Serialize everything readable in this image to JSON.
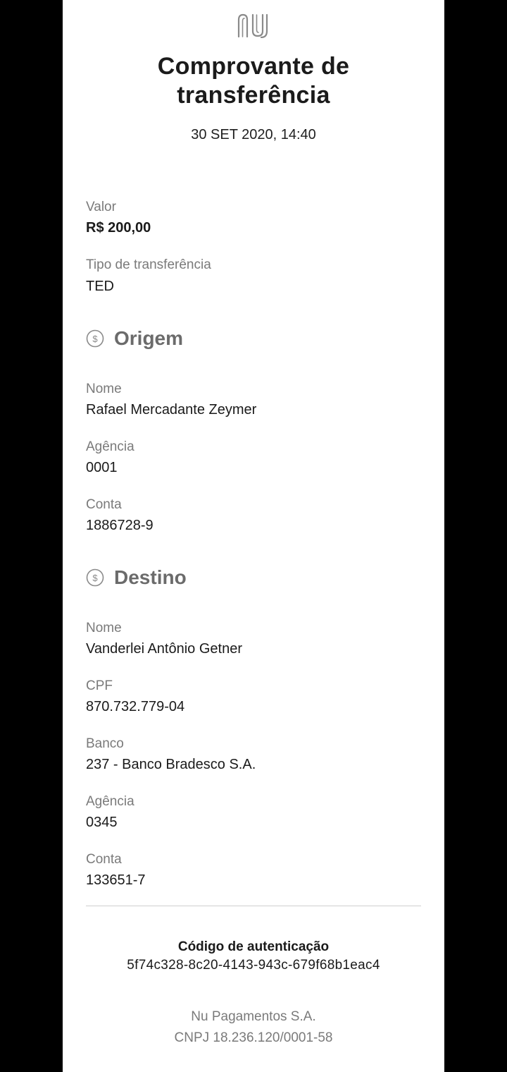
{
  "header": {
    "logo_icon": "nu-logo-icon",
    "title_line1": "Comprovante de",
    "title_line2": "transferência",
    "date": "30 SET 2020, 14:40"
  },
  "summary": {
    "valor_label": "Valor",
    "valor_value": "R$ 200,00",
    "tipo_label": "Tipo de transferência",
    "tipo_value": "TED"
  },
  "origem": {
    "icon": "money-circle-icon",
    "title": "Origem",
    "nome_label": "Nome",
    "nome_value": "Rafael Mercadante Zeymer",
    "agencia_label": "Agência",
    "agencia_value": "0001",
    "conta_label": "Conta",
    "conta_value": "1886728-9"
  },
  "destino": {
    "icon": "money-circle-icon",
    "title": "Destino",
    "nome_label": "Nome",
    "nome_value": "Vanderlei Antônio Getner",
    "cpf_label": "CPF",
    "cpf_value": "870.732.779-04",
    "banco_label": "Banco",
    "banco_value": "237 - Banco Bradesco S.A.",
    "agencia_label": "Agência",
    "agencia_value": "0345",
    "conta_label": "Conta",
    "conta_value": "133651-7"
  },
  "auth": {
    "label": "Código de autenticação",
    "code": "5f74c328-8c20-4143-943c-679f68b1eac4"
  },
  "footer": {
    "company": "Nu Pagamentos S.A.",
    "cnpj": "CNPJ 18.236.120/0001-58"
  },
  "colors": {
    "background": "#000000",
    "card": "#ffffff",
    "label_gray": "#7a7a7a",
    "section_gray": "#6b6b6b",
    "text": "#1a1a1a"
  }
}
